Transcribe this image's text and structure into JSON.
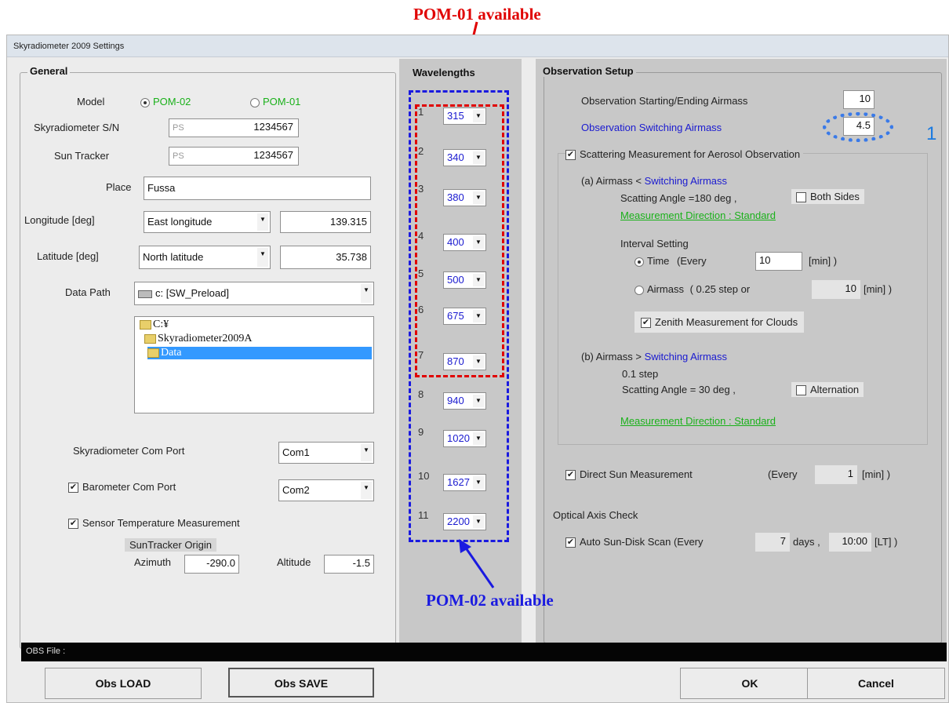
{
  "annotations": {
    "pom01": "POM-01 available",
    "pom02": "POM-02 available",
    "marker": "1"
  },
  "window": {
    "title": "Skyradiometer 2009 Settings"
  },
  "general": {
    "title": "General",
    "model_label": "Model",
    "model_options": [
      "POM-02",
      "POM-01"
    ],
    "model_selected": "POM-02",
    "sn_label": "Skyradiometer S/N",
    "sn_prefix": "PS",
    "sn_value": "1234567",
    "tracker_label": "Sun Tracker",
    "tracker_prefix": "PS",
    "tracker_value": "1234567",
    "place_label": "Place",
    "place_value": "Fussa",
    "longitude_label": "Longitude [deg]",
    "longitude_dir": "East longitude",
    "longitude_value": "139.315",
    "latitude_label": "Latitude [deg]",
    "latitude_dir": "North latitude",
    "latitude_value": "35.738",
    "datapath_label": "Data Path",
    "datapath_value": "c: [SW_Preload]",
    "tree": [
      "C:¥",
      "Skyradiometer2009A",
      "Data"
    ],
    "skyport_label": "Skyradiometer Com Port",
    "skyport_value": "Com1",
    "baro_label": "Barometer Com Port",
    "baro_value": "Com2",
    "sensor_temp_label": "Sensor Temperature Measurement",
    "origin_label": "SunTracker Origin",
    "azimuth_label": "Azimuth",
    "azimuth_value": "-290.0",
    "altitude_label": "Altitude",
    "altitude_value": "-1.5"
  },
  "wavelengths": {
    "title": "Wavelengths",
    "items": [
      {
        "n": "1",
        "v": "315"
      },
      {
        "n": "2",
        "v": "340"
      },
      {
        "n": "3",
        "v": "380"
      },
      {
        "n": "4",
        "v": "400"
      },
      {
        "n": "5",
        "v": "500"
      },
      {
        "n": "6",
        "v": "675"
      },
      {
        "n": "7",
        "v": "870"
      },
      {
        "n": "8",
        "v": "940"
      },
      {
        "n": "9",
        "v": "1020"
      },
      {
        "n": "10",
        "v": "1627"
      },
      {
        "n": "11",
        "v": "2200"
      }
    ]
  },
  "observation": {
    "title": "Observation Setup",
    "start_end_label": "Observation Starting/Ending Airmass",
    "start_end_value": "10",
    "switching_label": "Observation Switching Airmass",
    "switching_value": "4.5",
    "scattering_label": "Scattering Measurement for Aerosol Observation",
    "a_prefix": "(a) Airmass <",
    "a_link": "Switching Airmass",
    "a_angle": "Scatting Angle =180 deg ,",
    "both_sides": "Both Sides",
    "a_direction": "Measurement Direction : Standard",
    "interval_label": "Interval Setting",
    "time_label": "Time",
    "time_prefix": "(Every",
    "time_value": "10",
    "time_unit": "[min] )",
    "airmass_label": "Airmass",
    "airmass_text": "( 0.25 step or",
    "airmass_value": "10",
    "airmass_unit": "[min] )",
    "zenith_label": "Zenith Measurement for Clouds",
    "b_prefix": "(b) Airmass >",
    "b_link": "Switching Airmass",
    "b_step": "0.1 step",
    "b_angle": "Scatting Angle = 30 deg ,",
    "alternation": "Alternation",
    "b_direction": "Measurement Direction : Standard",
    "direct_sun_label": "Direct Sun Measurement",
    "direct_sun_prefix": "(Every",
    "direct_sun_value": "1",
    "direct_sun_unit": "[min] )",
    "optical_label": "Optical Axis  Check",
    "auto_scan_label": "Auto Sun-Disk Scan (Every",
    "auto_scan_days": "7",
    "auto_scan_days_unit": "days ,",
    "auto_scan_time": "10:00",
    "auto_scan_unit": "[LT] )"
  },
  "status": {
    "obs_file_label": "OBS File :"
  },
  "buttons": {
    "load": "Obs LOAD",
    "save": "Obs SAVE",
    "ok": "OK",
    "cancel": "Cancel"
  }
}
